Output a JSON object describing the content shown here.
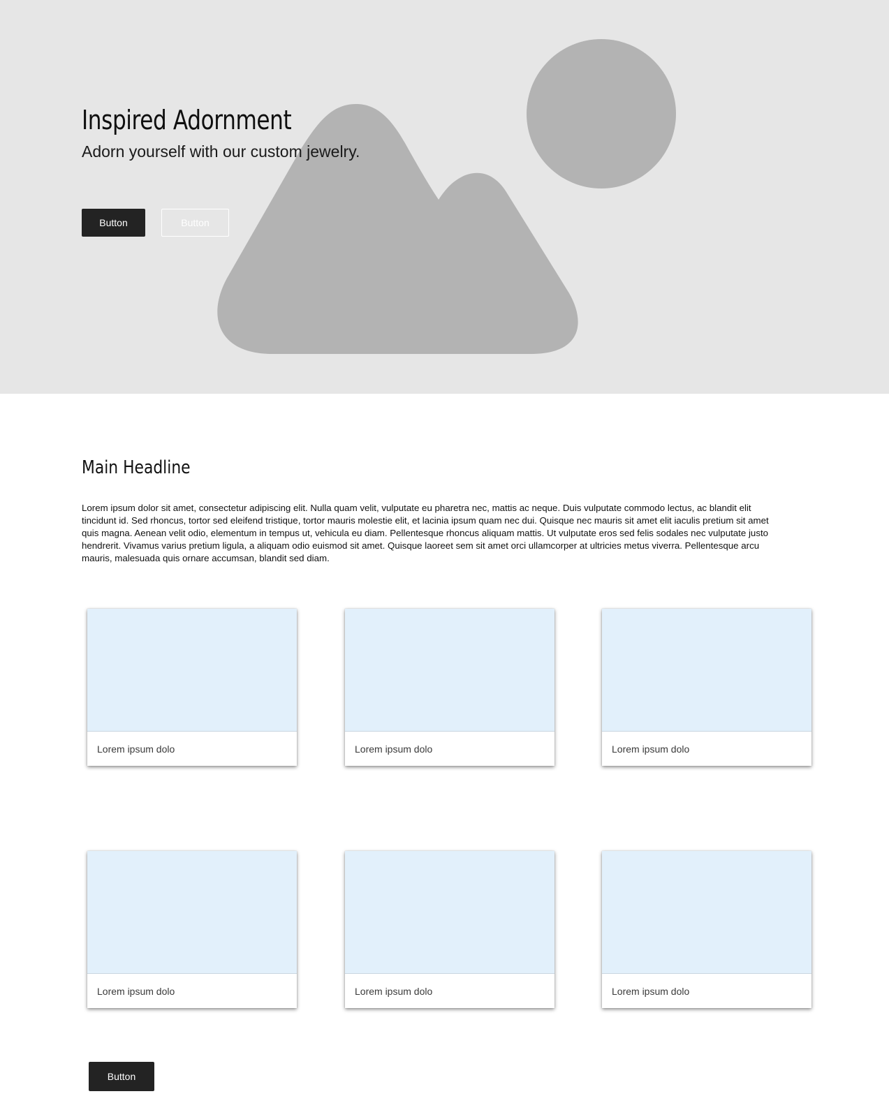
{
  "hero": {
    "title": "Inspired Adornment",
    "subtitle": "Adorn yourself with our custom jewelry.",
    "primary_button": "Button",
    "secondary_button": "Button",
    "image_icon": "image-placeholder-icon"
  },
  "main": {
    "headline": "Main Headline",
    "body": "Lorem ipsum dolor sit amet, consectetur adipiscing elit. Nulla quam velit, vulputate eu pharetra nec, mattis ac neque. Duis vulputate commodo lectus, ac blandit elit tincidunt id. Sed rhoncus, tortor sed eleifend tristique, tortor mauris molestie elit, et lacinia ipsum quam nec dui. Quisque nec mauris sit amet elit iaculis pretium sit amet quis magna. Aenean velit odio, elementum in tempus ut, vehicula eu diam. Pellentesque rhoncus aliquam mattis. Ut vulputate eros sed felis sodales nec vulputate justo hendrerit. Vivamus varius pretium ligula, a aliquam odio euismod sit amet. Quisque laoreet sem sit amet orci ullamcorper at ultricies metus viverra. Pellentesque arcu mauris, malesuada quis ornare accumsan, blandit sed diam."
  },
  "cards": [
    {
      "label": "Lorem ipsum dolo"
    },
    {
      "label": "Lorem ipsum dolo"
    },
    {
      "label": "Lorem ipsum dolo"
    },
    {
      "label": "Lorem ipsum dolo"
    },
    {
      "label": "Lorem ipsum dolo"
    },
    {
      "label": "Lorem ipsum dolo"
    }
  ],
  "footer": {
    "button": "Button"
  },
  "colors": {
    "hero_background": "#e6e6e6",
    "placeholder_shape": "#b3b3b3",
    "card_media": "#e2f0fb",
    "button_dark": "#232323"
  }
}
